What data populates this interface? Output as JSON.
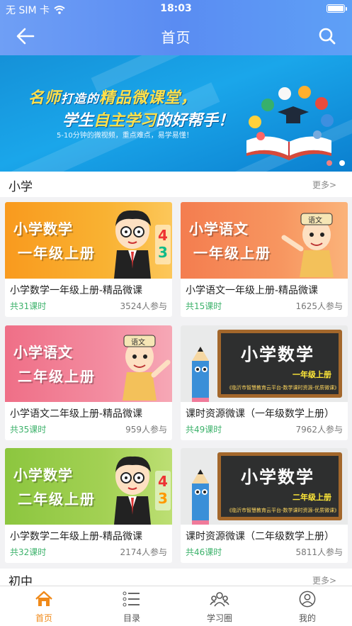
{
  "status_bar": {
    "carrier": "无 SIM 卡",
    "time": "18:03"
  },
  "nav": {
    "title": "首页",
    "back_icon": "back-arrow-icon",
    "search_icon": "search-icon"
  },
  "banner": {
    "line1_a": "名师",
    "line1_b": "打造的",
    "line1_c": "精品微课堂，",
    "line2_a": "学生",
    "line2_b": "自主学习",
    "line2_c": "的好帮手！",
    "line3": "5-10分钟的微视频，重点难点，易学易懂！",
    "slide_index": 1,
    "slide_count": 2
  },
  "section_primary": {
    "title": "小学",
    "more": "更多>"
  },
  "section_junior": {
    "title": "初中",
    "more": "更多>"
  },
  "courses": [
    {
      "title": "小学数学一年级上册-精品微课",
      "lessons": "共31课时",
      "learners": "3524人参与",
      "thumb_subject": "小学数学",
      "thumb_grade": "一年级上册",
      "thumb_style": "orange",
      "mascot": "3"
    },
    {
      "title": "小学语文一年级上册-精品微课",
      "lessons": "共15课时",
      "learners": "1625人参与",
      "thumb_subject": "小学语文",
      "thumb_grade": "一年级上册",
      "thumb_style": "coral",
      "mascot": "语文"
    },
    {
      "title": "小学语文二年级上册-精品微课",
      "lessons": "共35课时",
      "learners": "959人参与",
      "thumb_subject": "小学语文",
      "thumb_grade": "二年级上册",
      "thumb_style": "pink",
      "mascot": "语文"
    },
    {
      "title": "课时资源微课（一年级数学上册）",
      "lessons": "共49课时",
      "learners": "7962人参与",
      "board_title": "小学数学",
      "board_grade": "一年级上册",
      "board_footer": "《临沂市智慧教育云平台-数学课时资源-优质微课》",
      "thumb_style": "board"
    },
    {
      "title": "小学数学二年级上册-精品微课",
      "lessons": "共32课时",
      "learners": "2174人参与",
      "thumb_subject": "小学数学",
      "thumb_grade": "二年级上册",
      "thumb_style": "green",
      "mascot": "3"
    },
    {
      "title": "课时资源微课（二年级数学上册）",
      "lessons": "共46课时",
      "learners": "5811人参与",
      "board_title": "小学数学",
      "board_grade": "二年级上册",
      "board_footer": "《临沂市智慧教育云平台-数学课时资源-优质微课》",
      "thumb_style": "board"
    }
  ],
  "tabs": [
    {
      "label": "首页",
      "icon": "home-icon",
      "active": true
    },
    {
      "label": "目录",
      "icon": "list-icon",
      "active": false
    },
    {
      "label": "学习圈",
      "icon": "group-icon",
      "active": false
    },
    {
      "label": "我的",
      "icon": "user-icon",
      "active": false
    }
  ],
  "colors": {
    "accent": "#f08a1a",
    "header": "#6a9cf4",
    "lessons_green": "#3db26b"
  }
}
